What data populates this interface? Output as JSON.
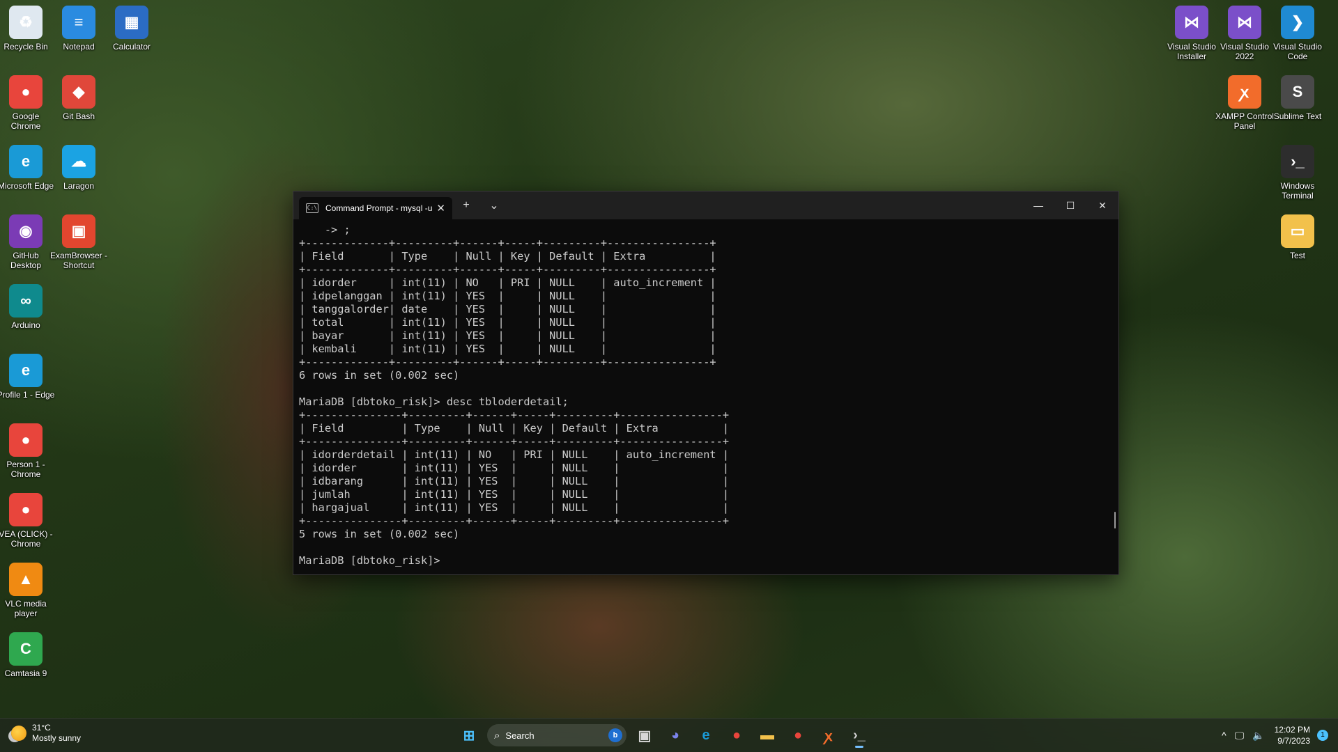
{
  "desktop_icons_left": [
    {
      "label": "Recycle Bin",
      "icon": "recycle-bin-icon",
      "color": "#dfe8f0",
      "glyph": "♻"
    },
    {
      "label": "Notepad",
      "icon": "notepad-icon",
      "color": "#2a8be0",
      "glyph": "≡"
    },
    {
      "label": "Calculator",
      "icon": "calculator-icon",
      "color": "#2b6cc4",
      "glyph": "▦"
    },
    {
      "label": "Google Chrome",
      "icon": "chrome-icon",
      "color": "#e8453c",
      "glyph": "●"
    },
    {
      "label": "Git Bash",
      "icon": "git-bash-icon",
      "color": "#e0473a",
      "glyph": "◆"
    },
    {
      "label": "Microsoft Edge",
      "icon": "edge-icon",
      "color": "#1a9ad6",
      "glyph": "e"
    },
    {
      "label": "Laragon",
      "icon": "laragon-icon",
      "color": "#1ba3e3",
      "glyph": "☁"
    },
    {
      "label": "GitHub Desktop",
      "icon": "github-desktop-icon",
      "color": "#7b3bb5",
      "glyph": "◉"
    },
    {
      "label": "ExamBrowser - Shortcut",
      "icon": "exambrowser-icon",
      "color": "#e2462f",
      "glyph": "▣"
    },
    {
      "label": "Arduino",
      "icon": "arduino-icon",
      "color": "#0f8a8d",
      "glyph": "∞"
    },
    {
      "label": "Profile 1 - Edge",
      "icon": "edge-profile-icon",
      "color": "#1a9ad6",
      "glyph": "e"
    },
    {
      "label": "Person 1 - Chrome",
      "icon": "chrome-person-icon",
      "color": "#e8453c",
      "glyph": "●"
    },
    {
      "label": "VEA (CLICK) - Chrome",
      "icon": "chrome-vea-icon",
      "color": "#e8453c",
      "glyph": "●"
    },
    {
      "label": "VLC media player",
      "icon": "vlc-icon",
      "color": "#f08a12",
      "glyph": "▲"
    },
    {
      "label": "Camtasia 9",
      "icon": "camtasia-icon",
      "color": "#2fa84f",
      "glyph": "C"
    }
  ],
  "desktop_icons_right": [
    {
      "label": "Visual Studio Installer",
      "icon": "vs-installer-icon",
      "color": "#7b4fc9",
      "glyph": "⋈"
    },
    {
      "label": "Visual Studio 2022",
      "icon": "visual-studio-icon",
      "color": "#7b4fc9",
      "glyph": "⋈"
    },
    {
      "label": "Visual Studio Code",
      "icon": "vscode-icon",
      "color": "#1f8ad2",
      "glyph": "❯"
    },
    {
      "label": "XAMPP Control Panel",
      "icon": "xampp-icon",
      "color": "#f26c2b",
      "glyph": "ꭗ"
    },
    {
      "label": "Sublime Text",
      "icon": "sublime-text-icon",
      "color": "#4a4a4a",
      "glyph": "S"
    },
    {
      "label": "Windows Terminal",
      "icon": "windows-terminal-icon",
      "color": "#2d2d2d",
      "glyph": "›_"
    },
    {
      "label": "Test",
      "icon": "folder-icon",
      "color": "#f2c14b",
      "glyph": "▭"
    }
  ],
  "terminal": {
    "tab_title": "Command Prompt - mysql  -u",
    "new_tab": "+",
    "dropdown": "⌄",
    "close_tab": "✕",
    "minimize": "—",
    "maximize": "☐",
    "close": "✕",
    "lines": [
      "    -> ;",
      "+-------------+---------+------+-----+---------+----------------+",
      "| Field       | Type    | Null | Key | Default | Extra          |",
      "+-------------+---------+------+-----+---------+----------------+",
      "| idorder     | int(11) | NO   | PRI | NULL    | auto_increment |",
      "| idpelanggan | int(11) | YES  |     | NULL    |                |",
      "| tanggalorder| date    | YES  |     | NULL    |                |",
      "| total       | int(11) | YES  |     | NULL    |                |",
      "| bayar       | int(11) | YES  |     | NULL    |                |",
      "| kembali     | int(11) | YES  |     | NULL    |                |",
      "+-------------+---------+------+-----+---------+----------------+",
      "6 rows in set (0.002 sec)",
      "",
      "MariaDB [dbtoko_risk]> desc tbloderdetail;",
      "+---------------+---------+------+-----+---------+----------------+",
      "| Field         | Type    | Null | Key | Default | Extra          |",
      "+---------------+---------+------+-----+---------+----------------+",
      "| idorderdetail | int(11) | NO   | PRI | NULL    | auto_increment |",
      "| idorder       | int(11) | YES  |     | NULL    |                |",
      "| idbarang      | int(11) | YES  |     | NULL    |                |",
      "| jumlah        | int(11) | YES  |     | NULL    |                |",
      "| hargajual     | int(11) | YES  |     | NULL    |                |",
      "+---------------+---------+------+-----+---------+----------------+",
      "5 rows in set (0.002 sec)",
      "",
      "MariaDB [dbtoko_risk]> "
    ]
  },
  "taskbar": {
    "weather_temp": "31°C",
    "weather_desc": "Mostly sunny",
    "search_placeholder": "Search",
    "bing_label": "b",
    "pinned": [
      {
        "name": "start-button",
        "glyph": "⊞",
        "color": "#4cc2ff"
      },
      {
        "name": "task-view-button",
        "glyph": "▣",
        "color": "#d8d8d8"
      },
      {
        "name": "teams-chat-button",
        "glyph": "◕",
        "color": "#7b83eb"
      },
      {
        "name": "taskbar-edge",
        "glyph": "e",
        "color": "#1a9ad6"
      },
      {
        "name": "taskbar-chrome",
        "glyph": "●",
        "color": "#e8453c"
      },
      {
        "name": "taskbar-file-explorer",
        "glyph": "▬",
        "color": "#f2c14b"
      },
      {
        "name": "taskbar-chrome-profile",
        "glyph": "●",
        "color": "#e8453c"
      },
      {
        "name": "taskbar-xampp",
        "glyph": "ꭗ",
        "color": "#f26c2b"
      },
      {
        "name": "taskbar-terminal",
        "glyph": "›_",
        "color": "#cfcfcf"
      }
    ],
    "tray_chevron": "^",
    "tray_network": "🖵",
    "tray_volume": "🔈",
    "time": "12:02 PM",
    "date": "9/7/2023",
    "notification_count": "1"
  }
}
